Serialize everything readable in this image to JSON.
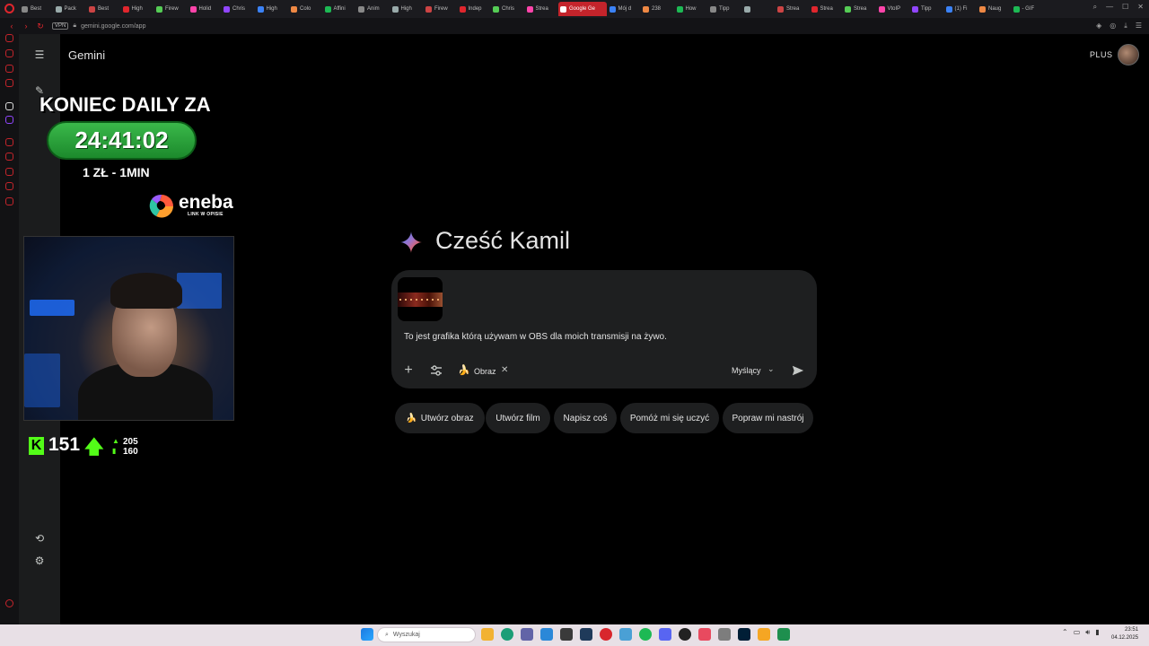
{
  "browser": {
    "tabs": [
      {
        "label": "Best"
      },
      {
        "label": "Pack"
      },
      {
        "label": "Best"
      },
      {
        "label": "High"
      },
      {
        "label": "Firew"
      },
      {
        "label": "Holid"
      },
      {
        "label": "Chris"
      },
      {
        "label": "High"
      },
      {
        "label": "Colo"
      },
      {
        "label": "Affini"
      },
      {
        "label": "Anim"
      },
      {
        "label": "High"
      },
      {
        "label": "Firew"
      },
      {
        "label": "Indep"
      },
      {
        "label": "Chris"
      },
      {
        "label": "Strea"
      },
      {
        "label": "Google Ge",
        "active": true
      },
      {
        "label": "Mój d"
      },
      {
        "label": "238"
      },
      {
        "label": "How"
      },
      {
        "label": "Tipp"
      },
      {
        "label": ""
      },
      {
        "label": "Strea"
      },
      {
        "label": "Strea"
      },
      {
        "label": "Strea"
      },
      {
        "label": "VtoIP"
      },
      {
        "label": "Tipp"
      },
      {
        "label": "(1) Fi"
      },
      {
        "label": "Naug"
      },
      {
        "label": "- GIF"
      }
    ],
    "vpn_label": "VPN",
    "url": "gemini.google.com/app"
  },
  "gemini": {
    "app_title": "Gemini",
    "plan_badge": "PLUS",
    "greeting": "Cześć Kamil",
    "composer": {
      "prompt_text": "To jest grafika którą używam w OBS dla moich transmisji na żywo.",
      "tool_chip_label": "Obraz",
      "tool_chip_icon": "🍌",
      "mode_label": "Myślący"
    },
    "suggestions": [
      {
        "label": "Utwórz obraz",
        "icon": "🍌"
      },
      {
        "label": "Utwórz film"
      },
      {
        "label": "Napisz coś"
      },
      {
        "label": "Pomóż mi się uczyć"
      },
      {
        "label": "Popraw mi nastrój"
      }
    ]
  },
  "overlay": {
    "daily_label": "KONIEC DAILY ZA",
    "timer": "24:41:02",
    "rate": "1 ZŁ - 1MIN",
    "sponsor_name": "eneba",
    "sponsor_sub": "LINK W OPISIE",
    "kick_count": "151",
    "stat_a": "205",
    "stat_b": "160"
  },
  "taskbar": {
    "search_placeholder": "Wyszukaj",
    "time": "23:51",
    "date": "04.12.2025"
  },
  "colors": {
    "opera_red": "#c4242b",
    "kick_green": "#53fc18",
    "timer_green": "#2fa83f",
    "composer_bg": "#1e1f20"
  }
}
